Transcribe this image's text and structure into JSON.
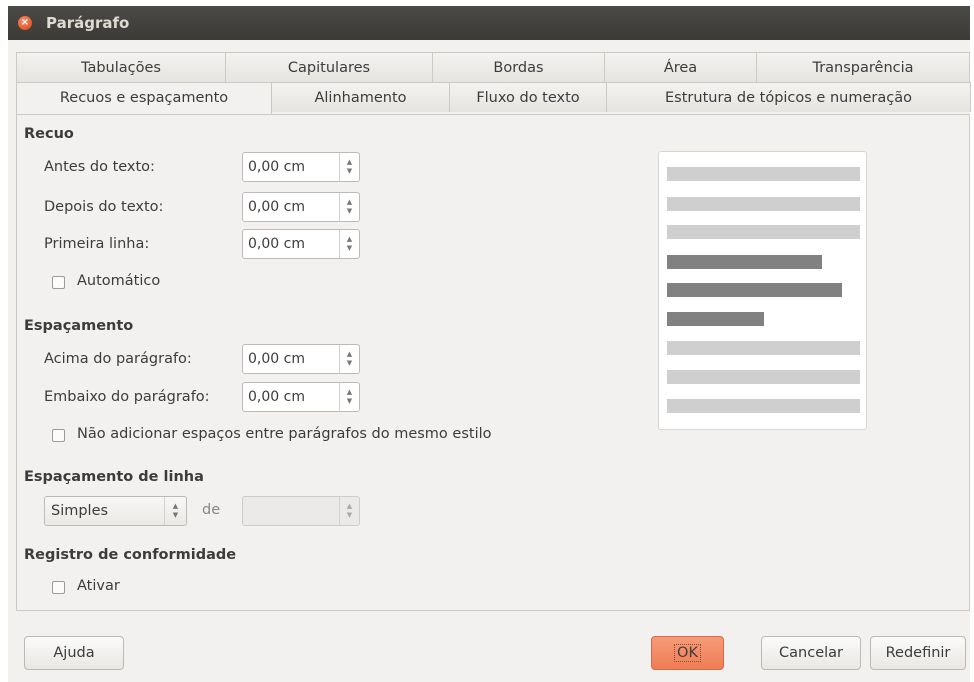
{
  "window": {
    "title": "Parágrafo"
  },
  "tabs_row1": [
    "Tabulações",
    "Capitulares",
    "Bordas",
    "Área",
    "Transparência"
  ],
  "tabs_row2": [
    "Recuos e espaçamento",
    "Alinhamento",
    "Fluxo do texto",
    "Estrutura de tópicos e numeração"
  ],
  "recuo": {
    "title": "Recuo",
    "antes_label": "Antes do texto:",
    "antes_value": "0,00 cm",
    "depois_label": "Depois do texto:",
    "depois_value": "0,00 cm",
    "primeira_label": "Primeira linha:",
    "primeira_value": "0,00 cm",
    "automatico_label": "Automático"
  },
  "espacamento": {
    "title": "Espaçamento",
    "acima_label": "Acima do parágrafo:",
    "acima_value": "0,00 cm",
    "embaixo_label": "Embaixo do parágrafo:",
    "embaixo_value": "0,00 cm",
    "nao_adicionar_label": "Não adicionar espaços entre parágrafos do mesmo estilo"
  },
  "espacamento_linha": {
    "title": "Espaçamento de linha",
    "selected": "Simples",
    "de_label": "de",
    "de_value": ""
  },
  "registro": {
    "title": "Registro de conformidade",
    "ativar_label": "Ativar"
  },
  "buttons": {
    "ajuda": "Ajuda",
    "ok": "OK",
    "cancelar": "Cancelar",
    "redefinir": "Redefinir"
  },
  "colors": {
    "accent": "#ee7d55",
    "titlebar": "#3c3b37",
    "preview_light": "#cfcfcf",
    "preview_dark": "#818181"
  }
}
